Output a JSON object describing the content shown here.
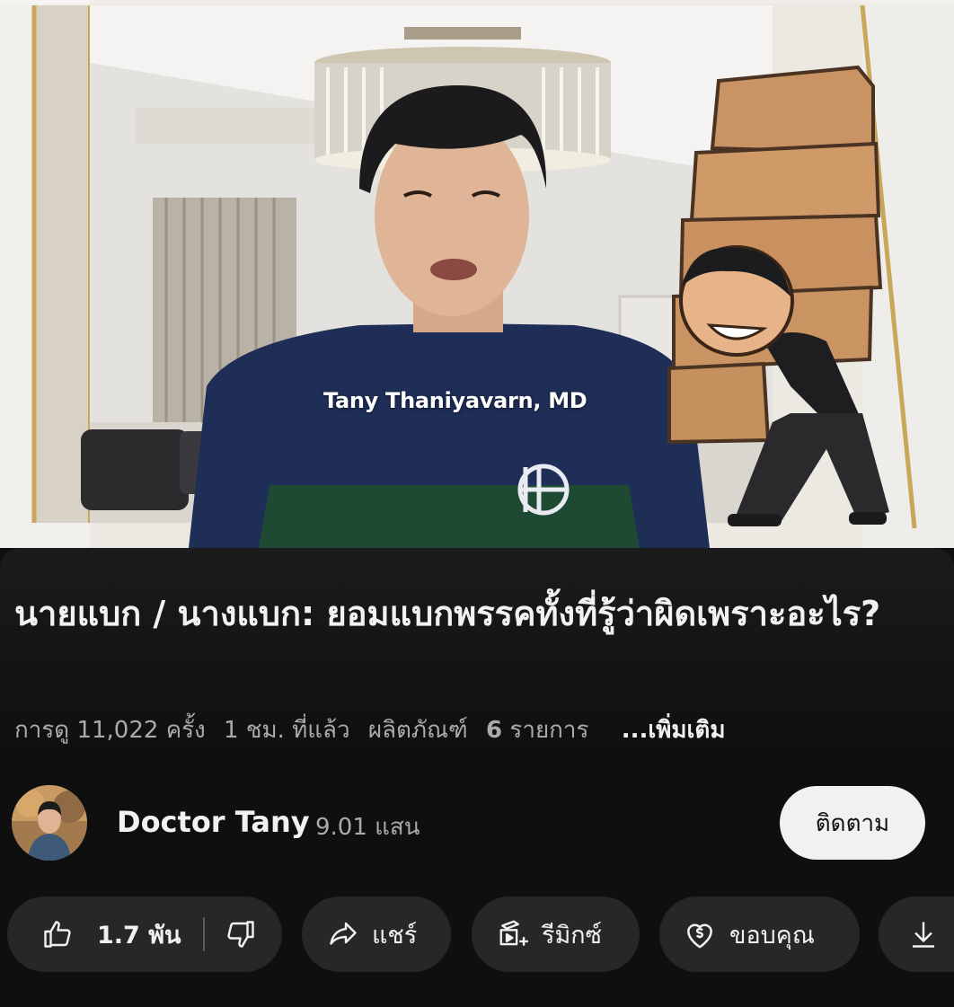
{
  "video": {
    "overlay_caption": "Tany Thaniyavarn, MD"
  },
  "title": "นายแบก / นางแบก: ยอมแบกพรรคทั้งที่รู้ว่าผิดเพราะอะไร?",
  "meta": {
    "views": "การดู 11,022 ครั้ง",
    "published": "1 ชม. ที่แล้ว",
    "products_label": "ผลิตภัณฑ์",
    "products_count": "6",
    "products_suffix": "รายการ",
    "more": "...เพิ่มเติม"
  },
  "channel": {
    "name": "Doctor Tany",
    "subscribers": "9.01 แสน",
    "subscribe_label": "ติดตาม"
  },
  "actions": {
    "like_count": "1.7 พัน",
    "share_label": "แชร์",
    "remix_label": "รีมิกซ์",
    "thanks_label": "ขอบคุณ"
  },
  "icons": {
    "like": "thumb-up-icon",
    "dislike": "thumb-down-icon",
    "share": "share-arrow-icon",
    "remix": "remix-icon",
    "thanks": "heart-dollar-icon",
    "download": "download-icon"
  }
}
